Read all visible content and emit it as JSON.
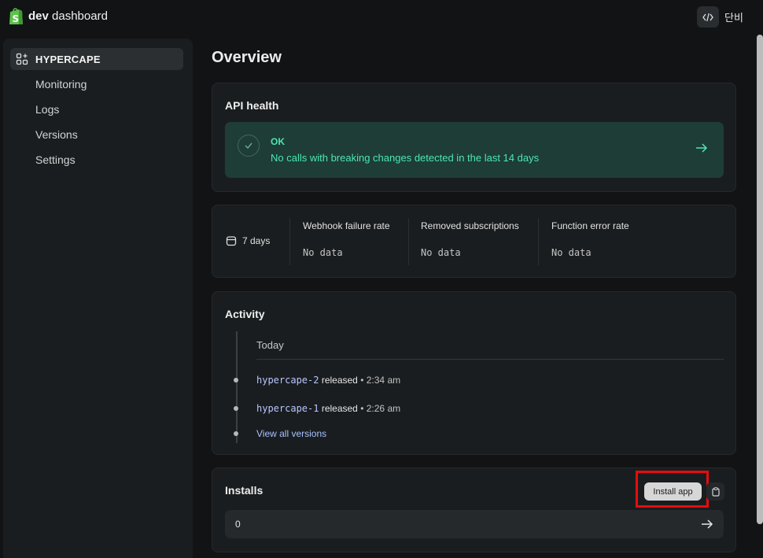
{
  "header": {
    "brand_bold": "dev",
    "brand_rest": "dashboard",
    "user_name": "단비"
  },
  "sidebar": {
    "app_name": "HYPERCAPE",
    "items": [
      {
        "label": "Monitoring"
      },
      {
        "label": "Logs"
      },
      {
        "label": "Versions"
      },
      {
        "label": "Settings"
      }
    ]
  },
  "main": {
    "title": "Overview",
    "api_health": {
      "title": "API health",
      "status": "OK",
      "message": "No calls with breaking changes detected in the last 14 days"
    },
    "metrics": {
      "period": "7 days",
      "items": [
        {
          "label": "Webhook failure rate",
          "value": "No data"
        },
        {
          "label": "Removed subscriptions",
          "value": "No data"
        },
        {
          "label": "Function error rate",
          "value": "No data"
        }
      ]
    },
    "activity": {
      "title": "Activity",
      "group_label": "Today",
      "releases": [
        {
          "version": "hypercape-2",
          "action": "released",
          "separator": "•",
          "time": "2:34 am"
        },
        {
          "version": "hypercape-1",
          "action": "released",
          "separator": "•",
          "time": "2:26 am"
        }
      ],
      "view_all": "View all versions"
    },
    "installs": {
      "title": "Installs",
      "install_button": "Install app",
      "count": "0"
    }
  },
  "colors": {
    "background": "#111315",
    "card": "#1a1d1f",
    "ok_accent": "#4ce6b2",
    "link": "#a6c3ff",
    "highlight": "#e60d0d"
  },
  "icons": [
    "shopify-logo-icon",
    "code-icon",
    "app-grid-icon",
    "calendar-icon",
    "check-icon",
    "arrow-right-icon",
    "clipboard-icon"
  ]
}
